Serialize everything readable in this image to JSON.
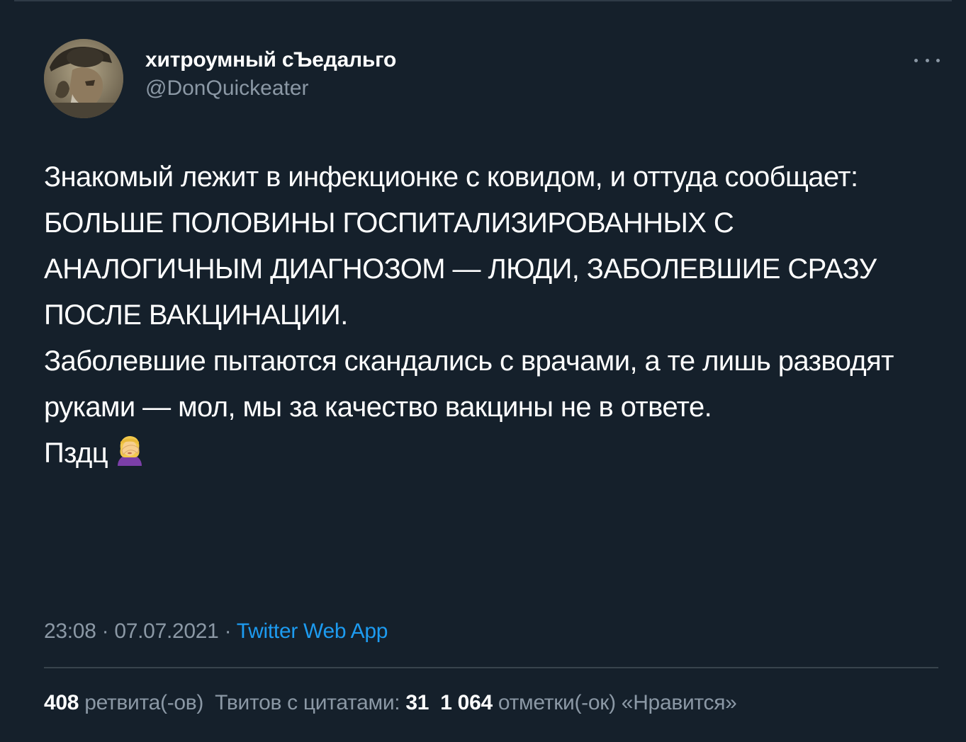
{
  "tweet": {
    "author": {
      "display_name": "хитроумный сЪедальго",
      "handle": "@DonQuickeater",
      "avatar_icon": "avatar-icon"
    },
    "more_icon": "more-options-icon",
    "text_lines": [
      "Знакомый лежит в инфекционке с ковидом, и оттуда сообщает: БОЛЬШЕ ПОЛОВИНЫ ГОСПИТАЛИЗИРОВАННЫХ С АНАЛОГИЧНЫМ ДИАГНОЗОМ — ЛЮДИ, ЗАБОЛЕВШИЕ СРАЗУ ПОСЛЕ ВАКЦИНАЦИИ.",
      "Заболевшие пытаются скандались с врачами, а те лишь разводят руками — мол, мы за качество вакцины не в ответе.",
      "Пздц"
    ],
    "emoji": "facepalm-woman-emoji",
    "time": "23:08",
    "separator": "·",
    "date": "07.07.2021",
    "source": "Twitter Web App",
    "stats": {
      "retweets_count": "408",
      "retweets_label": "ретвита(-ов)",
      "quotes_label": "Твитов с цитатами:",
      "quotes_count": "31",
      "likes_count": "1 064",
      "likes_label": "отметки(-ок) «Нравится»"
    }
  },
  "colors": {
    "background": "#15202b",
    "text": "#ffffff",
    "secondary_text": "#8b98a5",
    "link": "#1d9bf0",
    "divider": "#38444d"
  }
}
